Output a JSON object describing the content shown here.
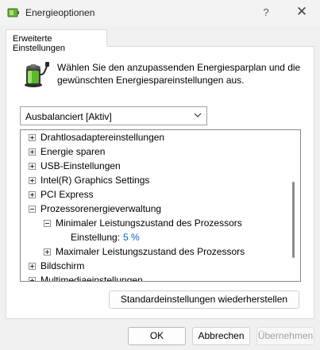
{
  "window": {
    "title": "Energieoptionen",
    "help": "?",
    "close": "✕"
  },
  "tab": {
    "label": "Erweiterte Einstellungen"
  },
  "intro": {
    "text": "Wählen Sie den anzupassenden Energiesparplan und die gewünschten Energiespareinstellungen aus."
  },
  "plan_select": {
    "value": "Ausbalanciert [Aktiv]"
  },
  "tree": {
    "items": [
      {
        "label": "Drahtlosadaptereinstellungen"
      },
      {
        "label": "Energie sparen"
      },
      {
        "label": "USB-Einstellungen"
      },
      {
        "label": "Intel(R) Graphics Settings"
      },
      {
        "label": "PCI Express"
      },
      {
        "label": "Prozessorenergieverwaltung"
      },
      {
        "label": "Minimaler Leistungszustand des Prozessors"
      },
      {
        "label": "Einstellung:",
        "value": "5 %"
      },
      {
        "label": "Maximaler Leistungszustand des Prozessors"
      },
      {
        "label": "Bildschirm"
      },
      {
        "label": "Multimediaeinstellungen"
      }
    ]
  },
  "buttons": {
    "restore": "Standardeinstellungen wiederherstellen",
    "ok": "OK",
    "cancel": "Abbrechen",
    "apply": "Übernehmen"
  },
  "colors": {
    "link": "#0066cc",
    "battery_green": "#5cb82a"
  },
  "icons": {
    "app": "power-options-icon",
    "battery": "battery-plug-icon"
  }
}
